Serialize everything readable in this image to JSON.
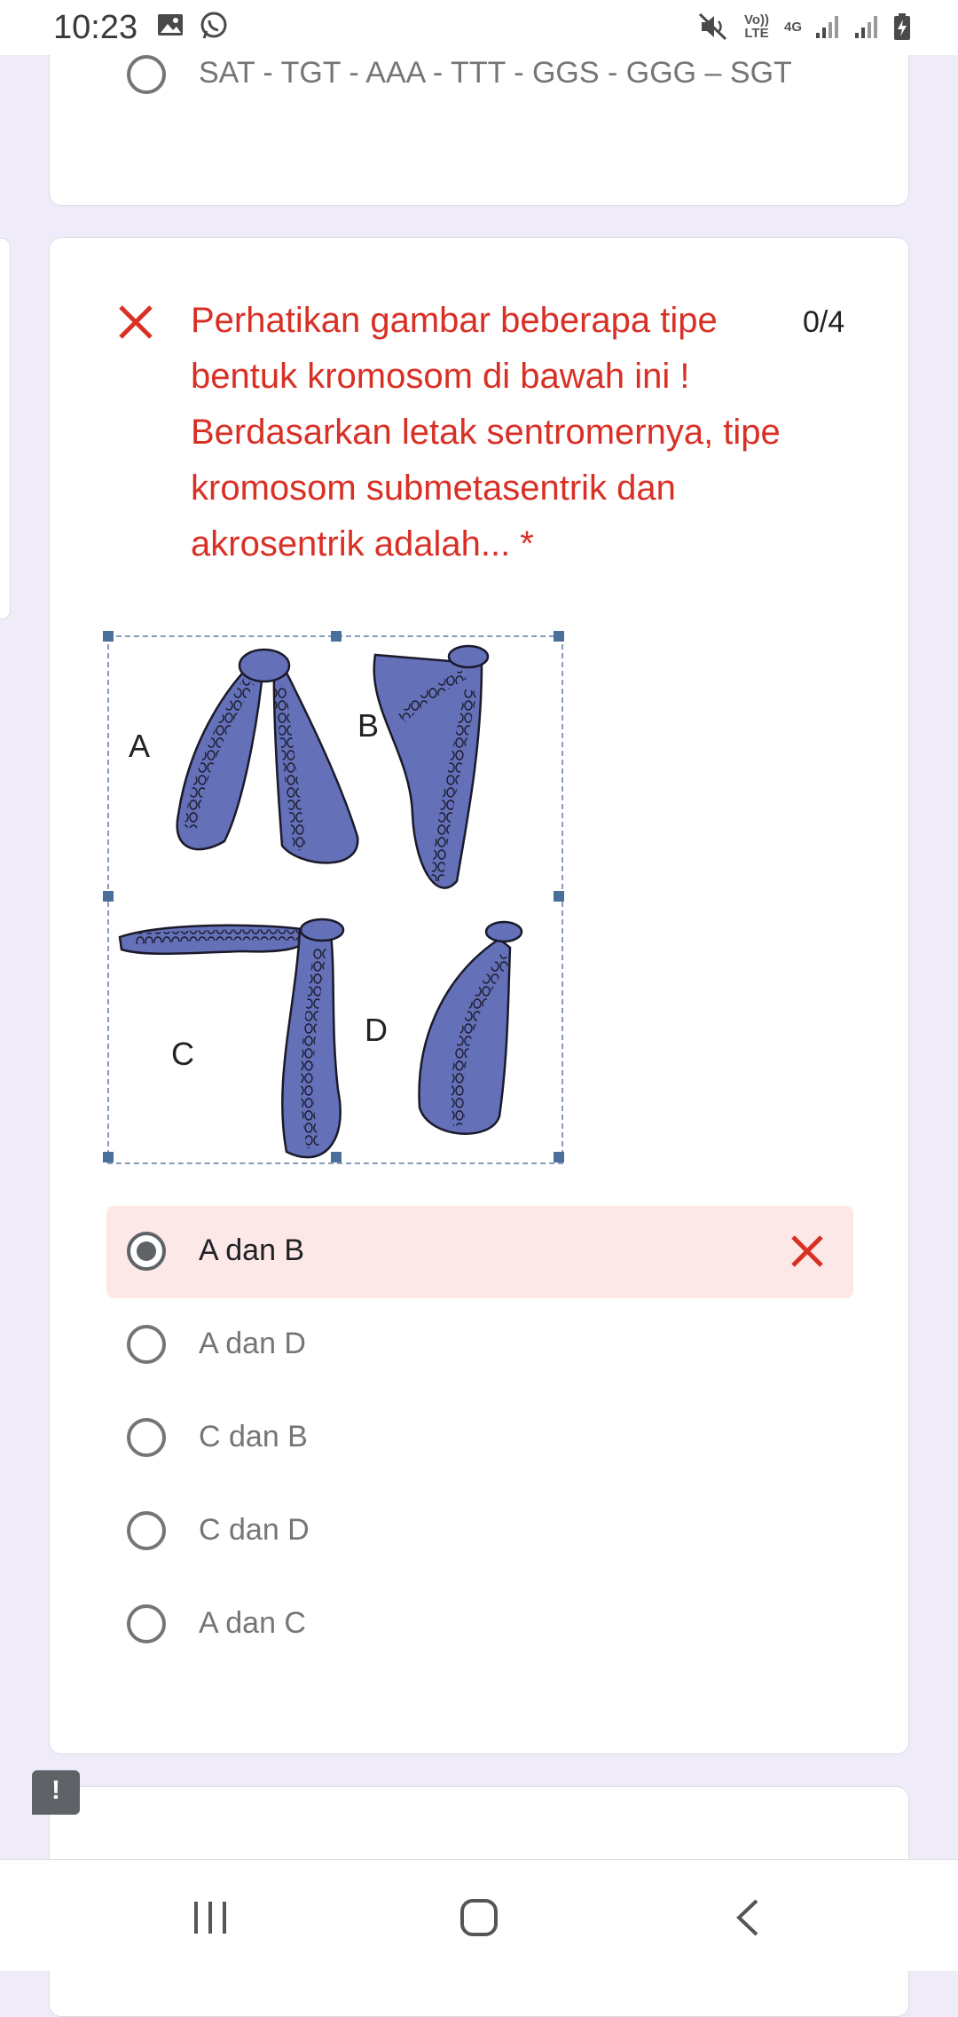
{
  "status_bar": {
    "time": "10:23",
    "network_top": "Vo)) LTE",
    "network_gen": "4G",
    "icons": [
      "image-icon",
      "whatsapp-icon",
      "mute-icon",
      "signal-icon",
      "signal-icon",
      "battery-icon"
    ]
  },
  "previous_question": {
    "last_option": "SAT - TGT - AAA - TTT - GGS - GGG – SGT"
  },
  "question": {
    "text": "Perhatikan gambar beberapa tipe bentuk kromosom di bawah ini ! Berdasarkan letak sentromernya, tipe kromosom submetasentrik dan akrosentrik adalah... *",
    "score": "0/4",
    "status": "incorrect",
    "figure_labels": [
      "A",
      "B",
      "C",
      "D"
    ],
    "options": [
      {
        "label": "A dan B",
        "selected": true,
        "incorrect": true
      },
      {
        "label": "A dan D",
        "selected": false
      },
      {
        "label": "C dan B",
        "selected": false
      },
      {
        "label": "C dan D",
        "selected": false
      },
      {
        "label": "A dan C",
        "selected": false
      }
    ]
  },
  "colors": {
    "background": "#efebf8",
    "error": "#d93025",
    "selected_bg": "#fce8e6",
    "chromosome": "#6470b8"
  }
}
